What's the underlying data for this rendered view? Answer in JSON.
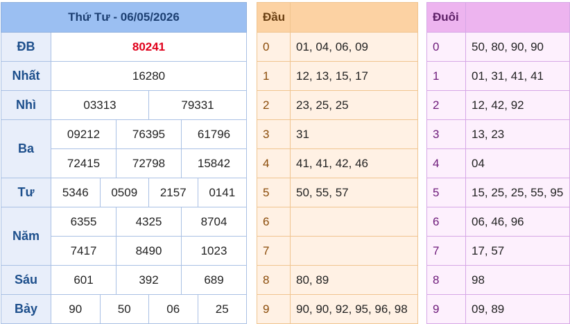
{
  "results": {
    "title": "Thứ Tư - 06/05/2026",
    "prizes": {
      "db": {
        "label": "ĐB",
        "numbers": [
          "80241"
        ]
      },
      "nhat": {
        "label": "Nhất",
        "numbers": [
          "16280"
        ]
      },
      "nhi": {
        "label": "Nhì",
        "numbers": [
          "03313",
          "79331"
        ]
      },
      "ba": {
        "label": "Ba",
        "numbers": [
          "09212",
          "76395",
          "61796",
          "72415",
          "72798",
          "15842"
        ]
      },
      "tu": {
        "label": "Tư",
        "numbers": [
          "5346",
          "0509",
          "2157",
          "0141"
        ]
      },
      "nam": {
        "label": "Năm",
        "numbers": [
          "6355",
          "4325",
          "8704",
          "7417",
          "8490",
          "1023"
        ]
      },
      "sau": {
        "label": "Sáu",
        "numbers": [
          "601",
          "392",
          "689"
        ]
      },
      "bay": {
        "label": "Bảy",
        "numbers": [
          "90",
          "50",
          "06",
          "25"
        ]
      }
    }
  },
  "dau": {
    "header": "Đầu",
    "rows": [
      {
        "digit": "0",
        "values": "01, 04, 06, 09"
      },
      {
        "digit": "1",
        "values": "12, 13, 15, 17"
      },
      {
        "digit": "2",
        "values": "23, 25, 25"
      },
      {
        "digit": "3",
        "values": "31"
      },
      {
        "digit": "4",
        "values": "41, 41, 42, 46"
      },
      {
        "digit": "5",
        "values": "50, 55, 57"
      },
      {
        "digit": "6",
        "values": ""
      },
      {
        "digit": "7",
        "values": ""
      },
      {
        "digit": "8",
        "values": "80, 89"
      },
      {
        "digit": "9",
        "values": "90, 90, 92, 95, 96, 98"
      }
    ]
  },
  "duoi": {
    "header": "Đuôi",
    "rows": [
      {
        "digit": "0",
        "values": "50, 80, 90, 90"
      },
      {
        "digit": "1",
        "values": "01, 31, 41, 41"
      },
      {
        "digit": "2",
        "values": "12, 42, 92"
      },
      {
        "digit": "3",
        "values": "13, 23"
      },
      {
        "digit": "4",
        "values": "04"
      },
      {
        "digit": "5",
        "values": "15, 25, 25, 55, 95"
      },
      {
        "digit": "6",
        "values": "06, 46, 96"
      },
      {
        "digit": "7",
        "values": "17, 57"
      },
      {
        "digit": "8",
        "values": "98"
      },
      {
        "digit": "9",
        "values": "09, 89"
      }
    ]
  },
  "colors": {
    "special_prize": "#e0001b",
    "results_header": "#9bbff2",
    "dau_header": "#fcd2a3",
    "duoi_header": "#edb4ef"
  }
}
